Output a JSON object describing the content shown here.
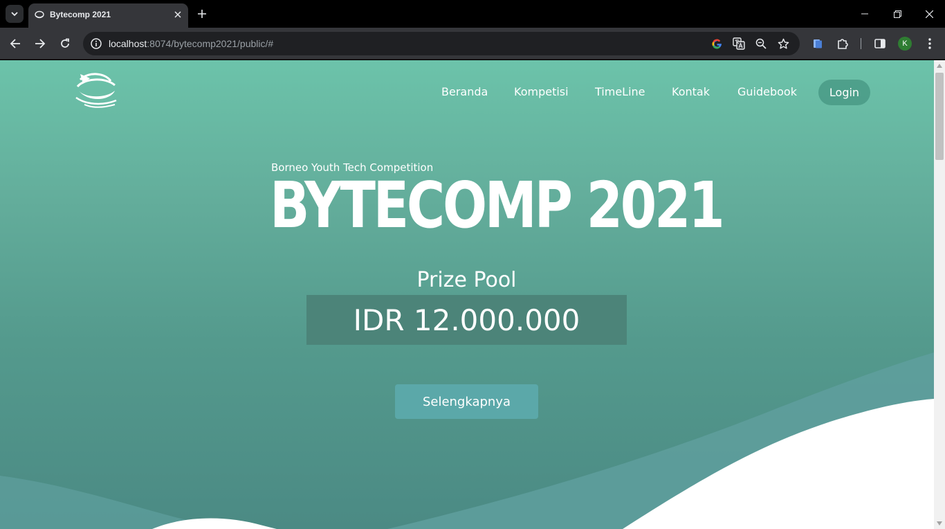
{
  "browser": {
    "tab_title": "Bytecomp 2021",
    "url_host": "localhost",
    "url_path": ":8074/bytecomp2021/public/#",
    "profile_initial": "K"
  },
  "page": {
    "nav": {
      "items": [
        "Beranda",
        "Kompetisi",
        "TimeLine",
        "Kontak",
        "Guidebook"
      ],
      "login": "Login"
    },
    "hero": {
      "subtitle": "Borneo Youth Tech Competition",
      "title": "BYTECOMP 2021",
      "prize_label": "Prize Pool",
      "prize_value": "IDR 12.000.000",
      "cta": "Selengkapnya"
    },
    "colors": {
      "gradient_top": "#6cc3aa",
      "gradient_bottom": "#4b8a84",
      "prize_box": "#4c8479",
      "cta_button": "#5ba8a9"
    }
  }
}
